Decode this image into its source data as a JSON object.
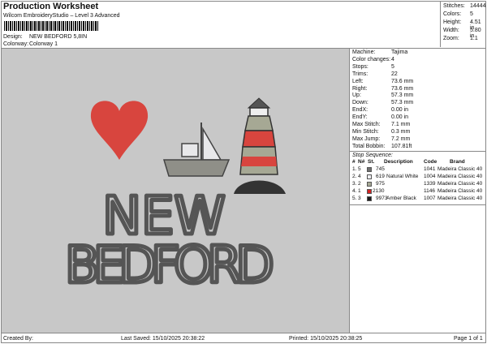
{
  "header": {
    "title": "Production Worksheet",
    "software": "Wilcom EmbroideryStudio – Level 3 Advanced",
    "design_label": "Design:",
    "design": "NEW BEDFORD 5,8IN",
    "colorway_label": "Colorway:",
    "colorway": "Colorway 1"
  },
  "stats": [
    {
      "label": "Stitches:",
      "value": "14444"
    },
    {
      "label": "Colors:",
      "value": "5"
    },
    {
      "label": "Height:",
      "value": "4.51 in"
    },
    {
      "label": "Width:",
      "value": "5.80 in"
    },
    {
      "label": "Zoom:",
      "value": "1:1"
    }
  ],
  "machine": [
    {
      "label": "Machine:",
      "value": "Tajima"
    },
    {
      "label": "Color changes:",
      "value": "4"
    },
    {
      "label": "Stops:",
      "value": "5"
    },
    {
      "label": "Trims:",
      "value": "22"
    },
    {
      "label": "Left:",
      "value": "73.6 mm"
    },
    {
      "label": "Right:",
      "value": "73.6 mm"
    },
    {
      "label": "Up:",
      "value": "57.3 mm"
    },
    {
      "label": "Down:",
      "value": "57.3 mm"
    },
    {
      "label": "EndX:",
      "value": "0.00 in"
    },
    {
      "label": "EndY:",
      "value": "0.00 in"
    },
    {
      "label": "Max Stitch:",
      "value": "7.1 mm"
    },
    {
      "label": "Min Stitch:",
      "value": "0.3 mm"
    },
    {
      "label": "Max Jump:",
      "value": "7.2 mm"
    },
    {
      "label": "Total Bobbin:",
      "value": "107.81ft"
    }
  ],
  "sequence": {
    "title": "Stop Sequence:",
    "headers": [
      "#",
      "N#",
      "St.",
      "Description",
      "Code",
      "Brand"
    ],
    "rows": [
      {
        "num": "1.",
        "n": "5",
        "color": "#707070",
        "st": "745",
        "desc": "",
        "code": "1041",
        "brand": "Madeira Classic 40"
      },
      {
        "num": "2.",
        "n": "4",
        "color": "#f0f0f4",
        "st": "619",
        "desc": "Natural White",
        "code": "1004",
        "brand": "Madeira Classic 40"
      },
      {
        "num": "3.",
        "n": "2",
        "color": "#a6a894",
        "st": "975",
        "desc": "",
        "code": "1339",
        "brand": "Madeira Classic 40"
      },
      {
        "num": "4.",
        "n": "1",
        "color": "#d42222",
        "st": "2130",
        "desc": "",
        "code": "1146",
        "brand": "Madeira Classic 40"
      },
      {
        "num": "5.",
        "n": "3",
        "color": "#1a1a1a",
        "st": "9973",
        "desc": "Amber Black",
        "code": "1007",
        "brand": "Madeira Classic 40"
      }
    ]
  },
  "artwork": {
    "line1": "NEW",
    "line2": "BEDFORD"
  },
  "footer": {
    "created": "Created By:",
    "saved": "Last Saved: 15/10/2025 20:38:22",
    "printed": "Printed: 15/10/2025 20:38:25",
    "page": "Page 1 of 1"
  }
}
